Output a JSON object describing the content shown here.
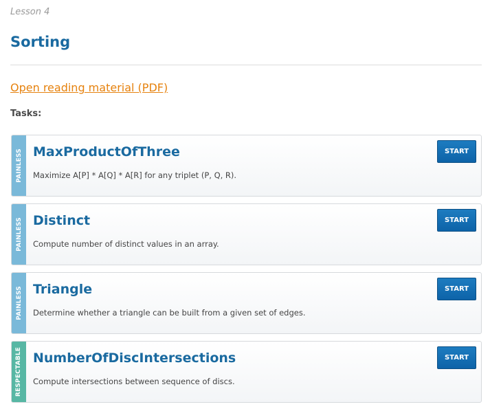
{
  "lesson": {
    "label": "Lesson 4",
    "title": "Sorting",
    "reading_link": "Open reading material (PDF)",
    "tasks_heading": "Tasks:"
  },
  "tasks": [
    {
      "difficulty": "Painless",
      "name": "MaxProductOfThree",
      "description": "Maximize A[P] * A[Q] * A[R] for any triplet (P, Q, R).",
      "button": "START"
    },
    {
      "difficulty": "Painless",
      "name": "Distinct",
      "description": "Compute number of distinct values in an array.",
      "button": "START"
    },
    {
      "difficulty": "Painless",
      "name": "Triangle",
      "description": "Determine whether a triangle can be built from a given set of edges.",
      "button": "START"
    },
    {
      "difficulty": "Respectable",
      "name": "NumberOfDiscIntersections",
      "description": "Compute intersections between sequence of discs.",
      "button": "START"
    }
  ],
  "colors": {
    "title_blue": "#1a6aa0",
    "link_orange": "#e6820e",
    "painless": "#7ab9d9",
    "respectable": "#57b7a4",
    "button_blue": "#0d63a8"
  }
}
